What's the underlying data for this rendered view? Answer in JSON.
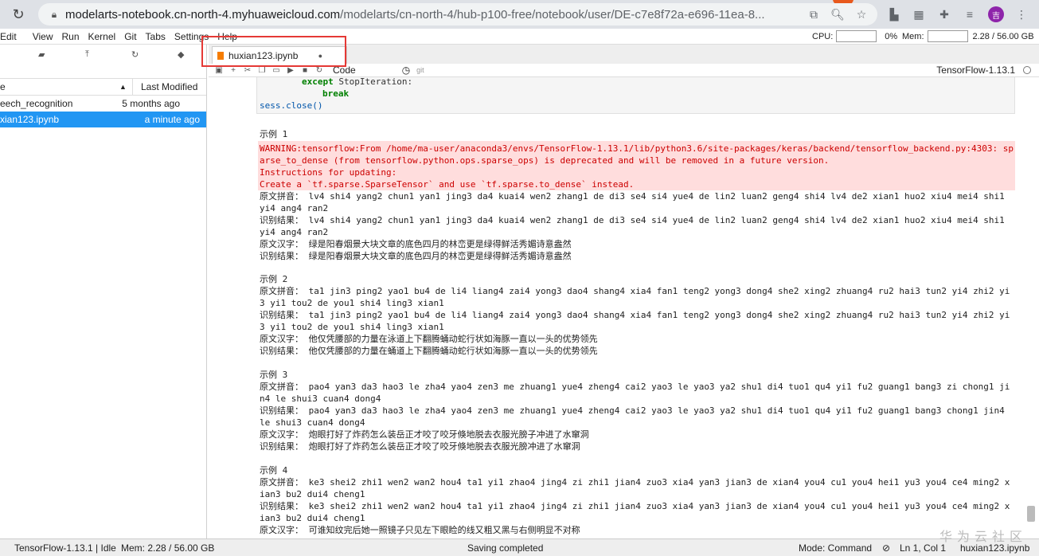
{
  "browser": {
    "url_host": "modelarts-notebook.cn-north-4.myhuaweicloud.com",
    "url_path": "/modelarts/cn-north-4/hub-p100-free/notebook/user/DE-c7e8f72a-e696-11ea-8...",
    "avatar_letter": "吉"
  },
  "menu": [
    "Edit",
    "View",
    "Run",
    "Kernel",
    "Git",
    "Tabs",
    "Settings",
    "Help"
  ],
  "resources": {
    "cpu_label": "CPU:",
    "cpu_value": "0%",
    "mem_label": "Mem:",
    "mem_value": "2.28 / 56.00 GB"
  },
  "file_browser": {
    "col_name": "e",
    "col_modified": "Last Modified",
    "rows": [
      {
        "name": "eech_recognition",
        "modified": "5 months ago"
      },
      {
        "name": "xian123.ipynb",
        "modified": "a minute ago"
      }
    ]
  },
  "tab": {
    "label": "huxian123.ipynb",
    "dirty": "●"
  },
  "notebook_toolbar": {
    "cell_type": "Code",
    "git": "git",
    "kernel": "TensorFlow-1.13.1"
  },
  "code": {
    "line1_kw": "except",
    "line1_rest": " StopIteration:",
    "line2_kw": "break",
    "line3_fn": "sess.close()"
  },
  "output": {
    "ex1_title": "示例 1",
    "warning": [
      "WARNING:tensorflow:From /home/ma-user/anaconda3/envs/TensorFlow-1.13.1/lib/python3.6/site-packages/keras/backend/tensorflow_backend.py:4303: sp",
      "arse_to_dense (from tensorflow.python.ops.sparse_ops) is deprecated and will be removed in a future version.",
      "Instructions for updating:",
      "Create a `tf.sparse.SparseTensor` and use `tf.sparse.to_dense` instead."
    ],
    "ex1_lines": [
      "原文拼音： lv4 shi4 yang2 chun1 yan1 jing3 da4 kuai4 wen2 zhang1 de di3 se4 si4 yue4 de lin2 luan2 geng4 shi4 lv4 de2 xian1 huo2 xiu4 mei4 shi1",
      "yi4 ang4 ran2",
      "识别结果： lv4 shi4 yang2 chun1 yan1 jing3 da4 kuai4 wen2 zhang1 de di3 se4 si4 yue4 de lin2 luan2 geng4 shi4 lv4 de2 xian1 huo2 xiu4 mei4 shi1",
      "yi4 ang4 ran2",
      "原文汉字： 绿是阳春烟景大块文章的底色四月的林峦更是绿得鲜活秀媚诗意盎然",
      "识别结果： 绿是阳春烟景大块文章的底色四月的林峦更是绿得鲜活秀媚诗意盎然"
    ],
    "ex2_title": "示例 2",
    "ex2_lines": [
      "原文拼音： ta1 jin3 ping2 yao1 bu4 de li4 liang4 zai4 yong3 dao4 shang4 xia4 fan1 teng2 yong3 dong4 she2 xing2 zhuang4 ru2 hai3 tun2 yi4 zhi2 yi",
      "3 yi1 tou2 de you1 shi4 ling3 xian1",
      "识别结果： ta1 jin3 ping2 yao1 bu4 de li4 liang4 zai4 yong3 dao4 shang4 xia4 fan1 teng2 yong3 dong4 she2 xing2 zhuang4 ru2 hai3 tun2 yi4 zhi2 yi",
      "3 yi1 tou2 de you1 shi4 ling3 xian1",
      "原文汉字： 他仅凭腰部的力量在泳道上下翻腾蛹动蛇行状如海豚一直以一头的优势领先",
      "识别结果： 他仅凭腰部的力量在蛹道上下翻腾蛹动蛇行状如海豚一直以一头的优势领先"
    ],
    "ex3_title": "示例 3",
    "ex3_lines": [
      "原文拼音： pao4 yan3 da3 hao3 le zha4 yao4 zen3 me zhuang1 yue4 zheng4 cai2 yao3 le yao3 ya2 shu1 di4 tuo1 qu4 yi1 fu2 guang1 bang3 zi chong1 ji",
      "n4 le shui3 cuan4 dong4",
      "识别结果： pao4 yan3 da3 hao3 le zha4 yao4 zen3 me zhuang1 yue4 zheng4 cai2 yao3 le yao3 ya2 shu1 di4 tuo1 qu4 yi1 fu2 guang1 bang3 chong1 jin4",
      "le shui3 cuan4 dong4",
      "原文汉字： 炮眼打好了炸药怎么装岳正才咬了咬牙倏地脱去衣服光膀子冲进了水窜洞",
      "识别结果： 炮眼打好了炸药怎么装岳正才咬了咬牙倏地脱去衣服光膀冲进了水窜洞"
    ],
    "ex4_title": "示例 4",
    "ex4_lines": [
      "原文拼音： ke3 shei2 zhi1 wen2 wan2 hou4 ta1 yi1 zhao4 jing4 zi zhi1 jian4 zuo3 xia4 yan3 jian3 de xian4 you4 cu1 you4 hei1 yu3 you4 ce4 ming2 x",
      "ian3 bu2 dui4 cheng1",
      "识别结果： ke3 shei2 zhi1 wen2 wan2 hou4 ta1 yi1 zhao4 jing4 zi zhi1 jian4 zuo3 xia4 yan3 jian3 de xian4 you4 cu1 you4 hei1 yu3 you4 ce4 ming2 x",
      "ian3 bu2 dui4 cheng1",
      "原文汉字： 可谁知纹完后她一照镜子只见左下眼睑的线又粗又黑与右侧明显不对称"
    ]
  },
  "status": {
    "kernel": "TensorFlow-1.13.1 | Idle",
    "mem": "Mem: 2.28 / 56.00 GB",
    "saving": "Saving completed",
    "mode": "Mode: Command",
    "position": "Ln 1, Col 1",
    "file": "huxian123.ipynb"
  },
  "watermark": "华为云社区"
}
